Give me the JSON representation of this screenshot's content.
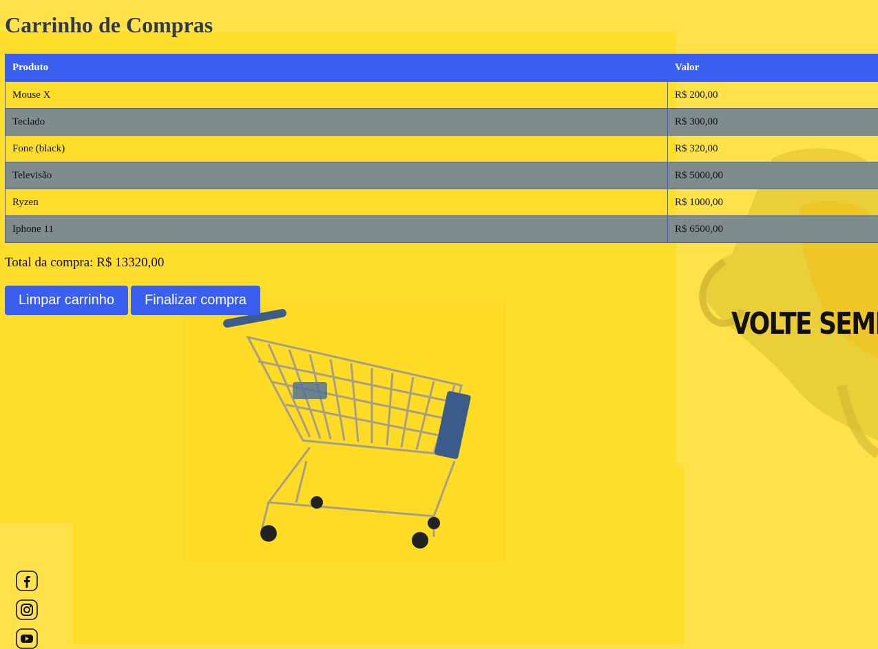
{
  "page": {
    "title": "Carrinho de Compras"
  },
  "cart": {
    "headers": {
      "product": "Produto",
      "value": "Valor"
    },
    "rows": [
      {
        "product": "Mouse X",
        "value": "R$ 200,00"
      },
      {
        "product": "Teclado",
        "value": "R$ 300,00"
      },
      {
        "product": "Fone (black)",
        "value": "R$ 320,00"
      },
      {
        "product": "Televisão",
        "value": "R$ 5000,00"
      },
      {
        "product": "Ryzen",
        "value": "R$ 1000,00"
      },
      {
        "product": "Iphone 11",
        "value": "R$ 6500,00"
      }
    ],
    "total": "Total da compra: R$ 13320,00"
  },
  "actions": {
    "clear_label": "Limpar carrinho",
    "finish_label": "Finalizar compra"
  },
  "banner": {
    "text": "VOLTE SEMP"
  },
  "social": {
    "icons": [
      "facebook-icon",
      "instagram-icon",
      "youtube-icon"
    ]
  },
  "colors": {
    "background": "#ffe24a",
    "accent": "#3a5ef0",
    "stripe": "#7f8c8d",
    "title": "#2f3a4d"
  }
}
